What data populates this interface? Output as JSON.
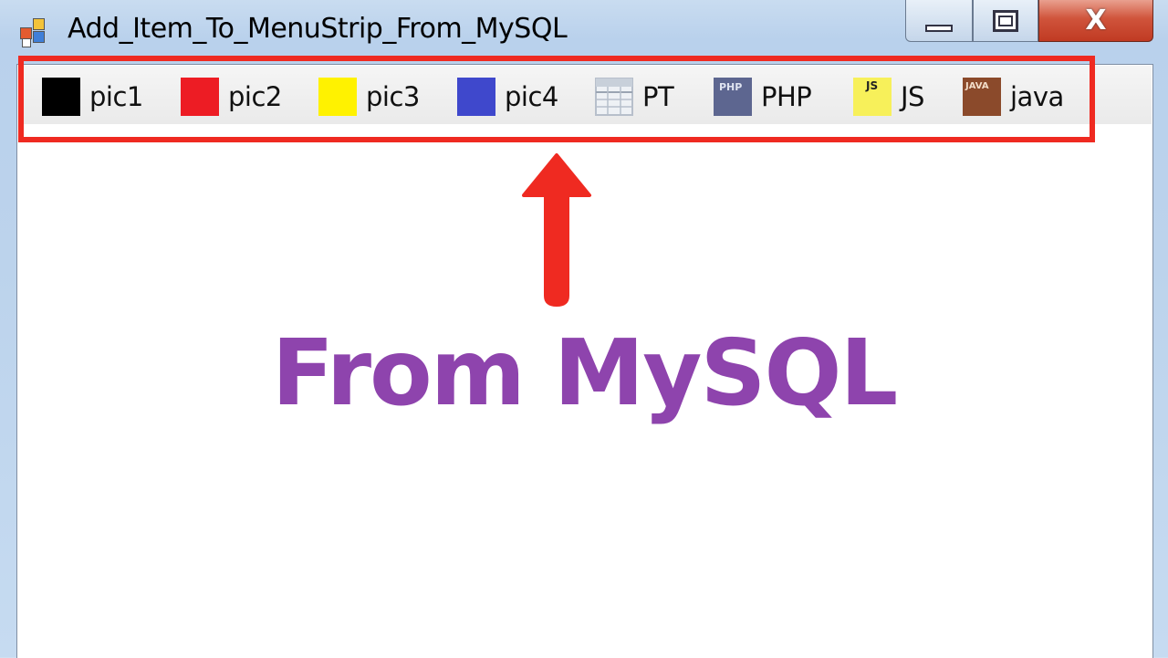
{
  "window": {
    "title": "Add_Item_To_MenuStrip_From_MySQL",
    "close_glyph": "X"
  },
  "menustrip": {
    "items": [
      {
        "label": "pic1",
        "icon": "black-square-icon",
        "color": "#000000"
      },
      {
        "label": "pic2",
        "icon": "red-square-icon",
        "color": "#ed1c24"
      },
      {
        "label": "pic3",
        "icon": "yellow-square-icon",
        "color": "#fff200"
      },
      {
        "label": "pic4",
        "icon": "blue-square-icon",
        "color": "#3f48cc"
      },
      {
        "label": "PT",
        "icon": "table-icon",
        "color": "#c8d0da"
      },
      {
        "label": "PHP",
        "icon": "php-icon",
        "color": "#5d6690",
        "icon_text": "PHP"
      },
      {
        "label": "JS",
        "icon": "js-icon",
        "color": "#f7f05a",
        "icon_text": "JS"
      },
      {
        "label": "java",
        "icon": "java-icon",
        "color": "#8b4a2b",
        "icon_text": "JAVA"
      }
    ]
  },
  "annotation": {
    "caption": "From MySQL",
    "accent_color": "#ef2a21",
    "caption_color": "#8e44ad"
  }
}
